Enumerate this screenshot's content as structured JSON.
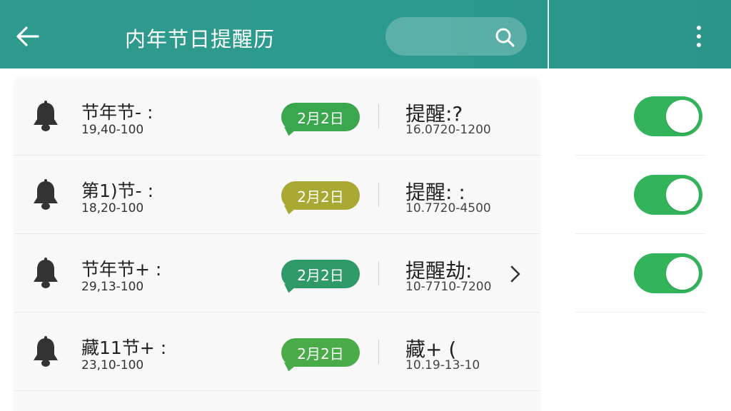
{
  "header": {
    "title": "内年节日提醒历",
    "search_placeholder": ""
  },
  "colors": {
    "header": "#2e9a8e",
    "toggle_on": "#33b45a"
  },
  "rows": [
    {
      "title": "节年节- :",
      "sub": "19,40-100",
      "date": "2月2日",
      "badge_color": "#3aa64e",
      "remind_title": "提醒:?",
      "remind_sub": "16.0720-1200"
    },
    {
      "title": "第1)节- :",
      "sub": "18,20-100",
      "date": "2月2日",
      "badge_color": "#a8a832",
      "remind_title": "提醒: :",
      "remind_sub": "10.7720-4500"
    },
    {
      "title": "节年节+ :",
      "sub": "29,13-100",
      "date": "2月2日",
      "badge_color": "#2f9a68",
      "remind_title": "提醒劫:",
      "remind_sub": "10-7710-7200"
    },
    {
      "title": "藏11节+ :",
      "sub": "23,10-100",
      "date": "2月2日",
      "badge_color": "#4aab49",
      "remind_title": "藏+ (",
      "remind_sub": "10.19-13-10"
    }
  ],
  "toggles": [
    {
      "on": true
    },
    {
      "on": true
    },
    {
      "on": true
    }
  ],
  "icons": {
    "back": "arrow-left-icon",
    "search": "search-icon",
    "more": "more-vertical-icon",
    "bell": "bell-icon",
    "chevron": "chevron-right-icon"
  }
}
